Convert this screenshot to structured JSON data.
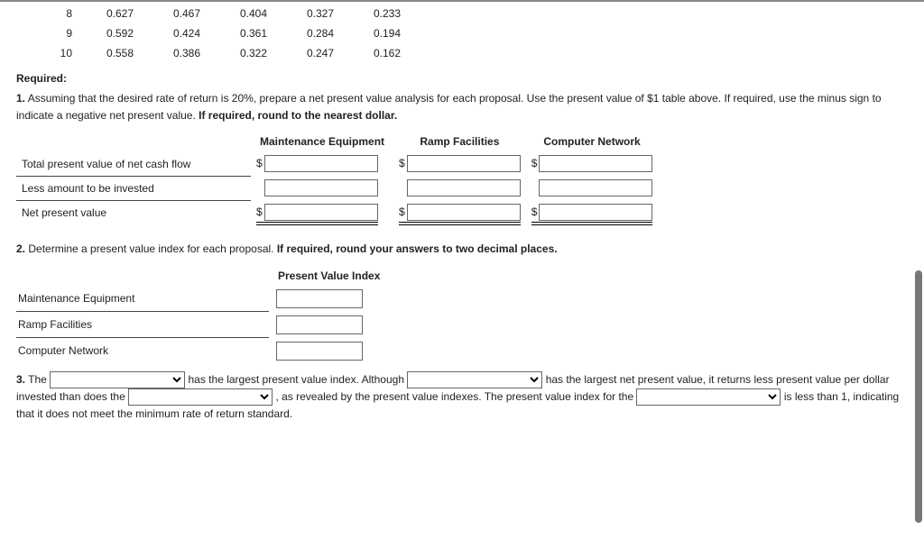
{
  "pv_table": {
    "rows": [
      {
        "n": "8",
        "c1": "0.627",
        "c2": "0.467",
        "c3": "0.404",
        "c4": "0.327",
        "c5": "0.233"
      },
      {
        "n": "9",
        "c1": "0.592",
        "c2": "0.424",
        "c3": "0.361",
        "c4": "0.284",
        "c5": "0.194"
      },
      {
        "n": "10",
        "c1": "0.558",
        "c2": "0.386",
        "c3": "0.322",
        "c4": "0.247",
        "c5": "0.162"
      }
    ]
  },
  "required_heading": "Required:",
  "q1": {
    "number": "1.",
    "text_a": " Assuming that the desired rate of return is 20%, prepare a net present value analysis for each proposal. Use the present value of $1 table above. If required, use the minus sign to indicate a negative net present value. ",
    "bold_tail": "If required, round to the nearest dollar.",
    "col_headers": {
      "c1": "Maintenance Equipment",
      "c2": "Ramp Facilities",
      "c3": "Computer Network"
    },
    "row_labels": {
      "r1": "Total present value of net cash flow",
      "r2": "Less amount to be invested",
      "r3": "Net present value"
    },
    "dollar": "$"
  },
  "q2": {
    "number": "2.",
    "text_a": " Determine a present value index for each proposal. ",
    "bold_tail": "If required, round your answers to two decimal places.",
    "col_header": "Present Value Index",
    "row_labels": {
      "r1": "Maintenance Equipment",
      "r2": "Ramp Facilities",
      "r3": "Computer Network"
    }
  },
  "q3": {
    "number": "3.",
    "frag1": " The ",
    "frag2": " has the largest present value index. Although ",
    "frag3": " has the largest net present value, it returns less present value per dollar invested than does the ",
    "frag4": " , as revealed by the present value indexes. The present value index for the ",
    "frag5": " is less than 1, indicating that it does not meet the minimum rate of return standard."
  }
}
